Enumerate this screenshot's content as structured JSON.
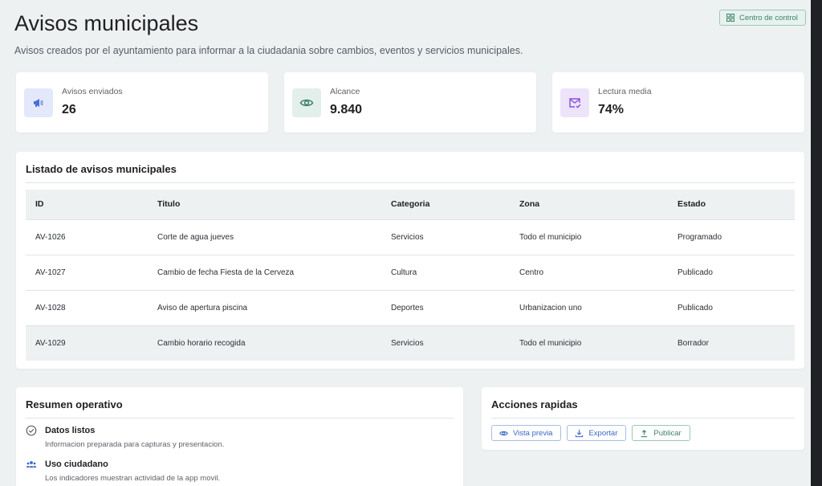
{
  "header": {
    "title": "Avisos municipales",
    "subtitle": "Avisos creados por el ayuntamiento para informar a la ciudadania sobre cambios, eventos y servicios municipales.",
    "control_label": "Centro de control"
  },
  "stats": [
    {
      "label": "Avisos enviados",
      "value": "26",
      "icon": "megaphone-icon",
      "color": "#4a6fd8",
      "bg": "#e3e9fb"
    },
    {
      "label": "Alcance",
      "value": "9.840",
      "icon": "eye-icon",
      "color": "#3d7f6a",
      "bg": "#e2efea"
    },
    {
      "label": "Lectura media",
      "value": "74%",
      "icon": "mail-check-icon",
      "color": "#8a4fd6",
      "bg": "#ede4fb"
    }
  ],
  "list": {
    "title": "Listado de avisos municipales",
    "columns": [
      "ID",
      "Titulo",
      "Categoria",
      "Zona",
      "Estado"
    ],
    "rows": [
      [
        "AV-1026",
        "Corte de agua jueves",
        "Servicios",
        "Todo el municipio",
        "Programado"
      ],
      [
        "AV-1027",
        "Cambio de fecha Fiesta de la Cerveza",
        "Cultura",
        "Centro",
        "Publicado"
      ],
      [
        "AV-1028",
        "Aviso de apertura piscina",
        "Deportes",
        "Urbanizacion uno",
        "Publicado"
      ],
      [
        "AV-1029",
        "Cambio horario recogida",
        "Servicios",
        "Todo el municipio",
        "Borrador"
      ]
    ]
  },
  "summary": {
    "title": "Resumen operativo",
    "items": [
      {
        "title": "Datos listos",
        "desc": "Informacion preparada para capturas y presentacion.",
        "icon": "check-circle-icon"
      },
      {
        "title": "Uso ciudadano",
        "desc": "Los indicadores muestran actividad de la app movil.",
        "icon": "users-icon"
      }
    ]
  },
  "actions": {
    "title": "Acciones rapidas",
    "preview": "Vista previa",
    "export": "Exportar",
    "publish": "Publicar"
  }
}
